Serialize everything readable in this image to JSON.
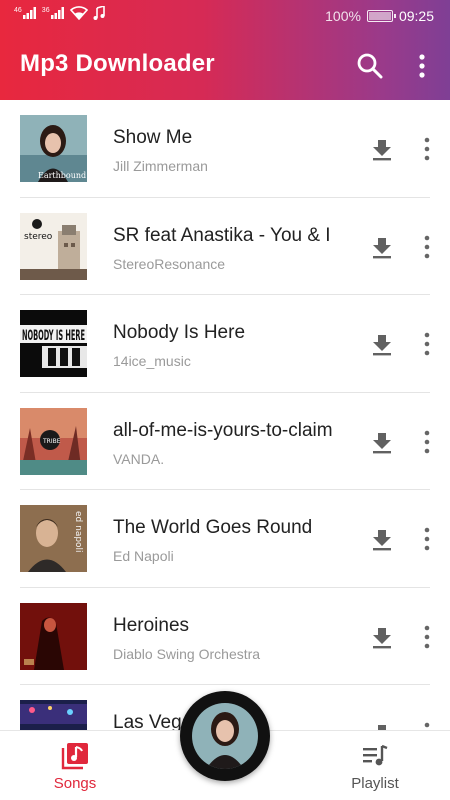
{
  "status": {
    "network_left": "46",
    "network_right": "36",
    "battery": "100%",
    "time": "09:25"
  },
  "appbar": {
    "title": "Mp3 Downloader",
    "search_icon": "search-icon",
    "more_icon": "more-vert-icon"
  },
  "songs": [
    {
      "title": "Show Me",
      "artist": "Jill Zimmerman",
      "art_text": "Earthbound"
    },
    {
      "title": "SR feat Anastika - You & I",
      "artist": "StereoResonance",
      "art_text": "stereo"
    },
    {
      "title": "Nobody Is Here",
      "artist": "14ice_music",
      "art_text": "NOBODY IS HERE"
    },
    {
      "title": "all-of-me-is-yours-to-claim",
      "artist": "VANDA.",
      "art_text": "TRIBE"
    },
    {
      "title": "The World Goes Round",
      "artist": "Ed Napoli",
      "art_text": "ed napoli"
    },
    {
      "title": "Heroines",
      "artist": "Diablo Swing Orchestra",
      "art_text": ""
    },
    {
      "title": "Las Vegas",
      "artist": "",
      "art_text": ""
    }
  ],
  "bottom_nav": {
    "songs_label": "Songs",
    "playlist_label": "Playlist"
  },
  "colors": {
    "accent": "#e0283c",
    "appbar_start": "#e8283e",
    "appbar_end": "#7f3f95"
  }
}
